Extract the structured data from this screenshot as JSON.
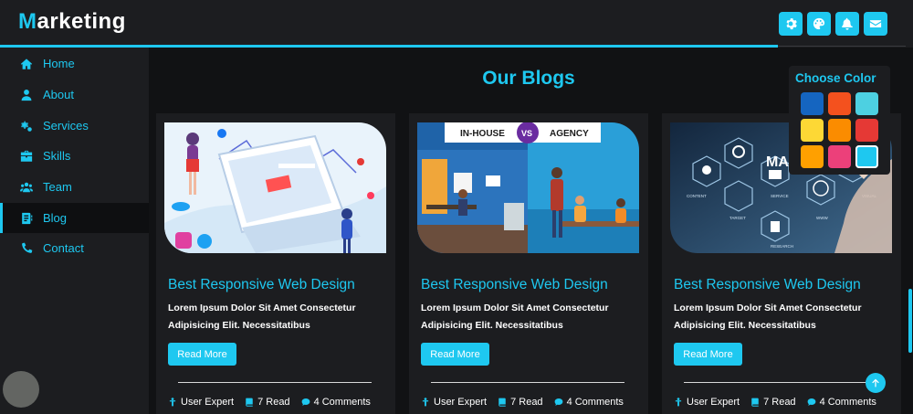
{
  "header": {
    "logo_first": "M",
    "logo_rest": "arketing",
    "buttons": [
      "settings-icon",
      "palette-icon",
      "bell-icon",
      "envelope-icon"
    ]
  },
  "sidebar": {
    "items": [
      {
        "label": "Home",
        "icon": "home-icon"
      },
      {
        "label": "About",
        "icon": "user-icon"
      },
      {
        "label": "Services",
        "icon": "gears-icon"
      },
      {
        "label": "Skills",
        "icon": "briefcase-icon"
      },
      {
        "label": "Team",
        "icon": "users-icon"
      },
      {
        "label": "Blog",
        "icon": "blog-icon",
        "active": true
      },
      {
        "label": "Contact",
        "icon": "phone-icon"
      }
    ]
  },
  "main": {
    "title": "Our Blogs",
    "cards": [
      {
        "title": "Best Responsive Web Design",
        "text": "Lorem Ipsum Dolor Sit Amet Consectetur Adipisicing Elit. Necessitatibus",
        "button": "Read More",
        "author": "User Expert",
        "read": "7 Read",
        "comments": "4 Comments"
      },
      {
        "title": "Best Responsive Web Design",
        "text": "Lorem Ipsum Dolor Sit Amet Consectetur Adipisicing Elit. Necessitatibus",
        "button": "Read More",
        "author": "User Expert",
        "read": "7 Read",
        "comments": "4 Comments",
        "image_text": {
          "left": "IN-HOUSE",
          "vs": "VS",
          "right": "AGENCY"
        }
      },
      {
        "title": "Best Responsive Web Design",
        "text": "Lorem Ipsum Dolor Sit Amet Consectetur Adipisicing Elit. Necessitatibus",
        "button": "Read More",
        "author": "User Expert",
        "read": "7 Read",
        "comments": "4 Comments",
        "image_text": {
          "big": "MA",
          "labels": [
            "CONTENT",
            "SERVICE",
            "VISUAL",
            "TARGET",
            "WWW",
            "RESEARCH"
          ]
        }
      }
    ]
  },
  "color_panel": {
    "title": "Choose Color",
    "swatches": [
      "#1565c0",
      "#f4511e",
      "#4dd0e1",
      "#fdd835",
      "#fb8c00",
      "#e53935",
      "#ffa000",
      "#ec407a",
      "#1ec8f0"
    ],
    "selected": "#1ec8f0"
  },
  "colors": {
    "accent": "#1ec8f0",
    "panel": "#1c1d20",
    "background": "#111214"
  }
}
